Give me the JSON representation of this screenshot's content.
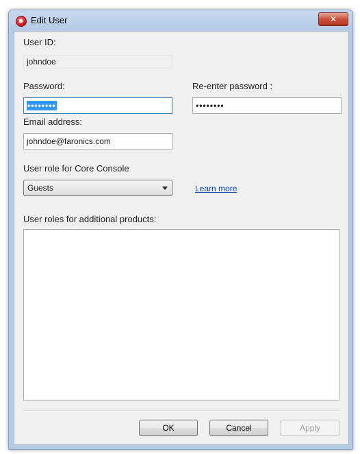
{
  "window": {
    "title": "Edit User",
    "close_glyph": "✕"
  },
  "form": {
    "user_id_label": "User ID:",
    "user_id_value": "johndoe",
    "password_label": "Password:",
    "password_value": "••••••••",
    "reenter_password_label": "Re-enter password :",
    "reenter_password_value": "••••••••",
    "email_label": "Email address:",
    "email_value": "johndoe@faronics.com",
    "role_label": "User role for Core Console",
    "role_selected": "Guests",
    "learn_more": "Learn more",
    "additional_roles_label": "User roles for additional products:"
  },
  "buttons": {
    "ok": "OK",
    "cancel": "Cancel",
    "apply": "Apply"
  },
  "icons": {
    "app": "faronics-app-icon",
    "close": "close-icon",
    "dropdown": "chevron-down-icon"
  }
}
